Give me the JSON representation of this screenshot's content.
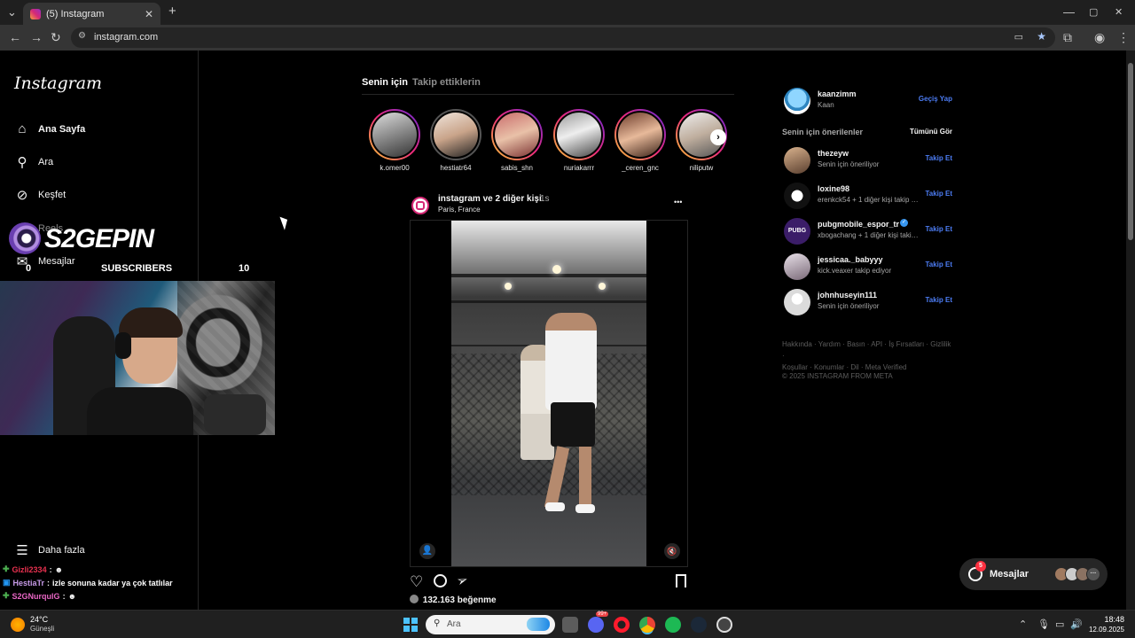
{
  "browser": {
    "tab_title": "(5) Instagram",
    "tab_close": "✕",
    "new_tab": "+",
    "url": "instagram.com",
    "window_controls": [
      "—",
      "▢",
      "✕"
    ]
  },
  "sidebar": {
    "logo": "Instagram",
    "items": [
      {
        "label": "Ana Sayfa",
        "icon": "home-icon",
        "glyph": "⌂"
      },
      {
        "label": "Ara",
        "icon": "search-icon",
        "glyph": "⚲"
      },
      {
        "label": "Keşfet",
        "icon": "compass-icon",
        "glyph": "⊘"
      },
      {
        "label": "Reels",
        "icon": "reels-icon",
        "glyph": "▣"
      },
      {
        "label": "Mesajlar",
        "icon": "messenger-icon",
        "glyph": "✉"
      }
    ],
    "more_label": "Daha fazla"
  },
  "stream_overlay": {
    "logo_text": "S2GEPIN",
    "subs_left": "0",
    "subs_label": "SUBSCRIBERS",
    "subs_right": "10"
  },
  "chat": [
    {
      "user": "Gizli2334",
      "sep": ":",
      "msg": "☻",
      "user_color": "#e8314f"
    },
    {
      "user": "HestiaTr",
      "sep": ":",
      "msg": "izle sonuna kadar ya çok tatlılar",
      "user_color": "#c79be8"
    },
    {
      "user": "S2GNurqulG",
      "sep": ":",
      "msg": "☻",
      "user_color": "#e866c4"
    }
  ],
  "feed": {
    "tabs": [
      {
        "label": "Senin için"
      },
      {
        "label": "Takip ettiklerin"
      }
    ],
    "stories": [
      {
        "name": "k.omer00",
        "seen": false
      },
      {
        "name": "hestiatr64",
        "seen": true
      },
      {
        "name": "sabis_shn",
        "seen": false
      },
      {
        "name": "nuriakarrr",
        "seen": false
      },
      {
        "name": "_ceren_gnc",
        "seen": false
      },
      {
        "name": "niliputw",
        "seen": false
      }
    ],
    "post": {
      "author": "instagram ve 2 diğer kişi",
      "time": "1s",
      "location": "Paris, France",
      "more": "•••",
      "likes": "132.163 beğenme"
    }
  },
  "right": {
    "me": {
      "username": "kaanzimm",
      "name": "Kaan",
      "switch_label": "Geçiş Yap"
    },
    "suggestions_title": "Senin için önerilenler",
    "see_all": "Tümünü Gör",
    "follow_label": "Takip Et",
    "suggestions": [
      {
        "username": "thezeyw",
        "sub": "Senin için öneriliyor",
        "verified": false
      },
      {
        "username": "loxine98",
        "sub": "erenkck54 + 1 diğer kişi takip ediyor",
        "verified": false
      },
      {
        "username": "pubgmobile_espor_tr",
        "sub": "xbogachang + 1 diğer kişi takip ediyor",
        "verified": true
      },
      {
        "username": "jessicaa._babyyy",
        "sub": "kick.veaxer takip ediyor",
        "verified": false
      },
      {
        "username": "johnhuseyin111",
        "sub": "Senin için öneriliyor",
        "verified": false
      }
    ],
    "footer_line1": "Hakkında · Yardım · Basın · API · İş Fırsatları · Gizlilik ·",
    "footer_line2": "Koşullar · Konumlar · Dil · Meta Verified",
    "copyright": "© 2025 INSTAGRAM FROM META"
  },
  "messages_pill": {
    "label": "Mesajlar",
    "badge": "5",
    "more": "···"
  },
  "taskbar": {
    "weather_temp": "24°C",
    "weather_desc": "Güneşli",
    "search_placeholder": "Ara",
    "discord_badge": "99+",
    "time": "18:48",
    "date": "12.09.2025"
  }
}
